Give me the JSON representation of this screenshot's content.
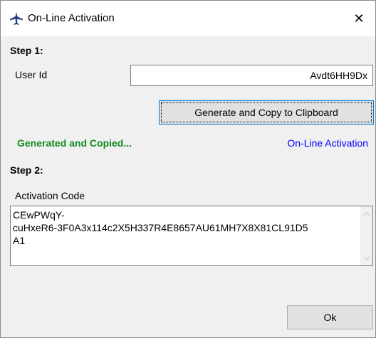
{
  "window": {
    "title": "On-Line Activation",
    "close_glyph": "✕"
  },
  "step1": {
    "heading": "Step 1:",
    "user_id_label": "User Id",
    "user_id_value": "Avdt6HH9Dx",
    "generate_button": "Generate and Copy to Clipboard",
    "status": "Generated and Copied...",
    "activation_link": "On-Line Activation"
  },
  "step2": {
    "heading": "Step 2:",
    "activation_code_label": "Activation Code",
    "activation_code_line1": "CEwPWqY-",
    "activation_code_line2": "cuHxeR6-3F0A3x114c2X5H337R4E8657AU61MH7X8X81CL91D5",
    "activation_code_line3": "A1"
  },
  "footer": {
    "ok_button": "Ok"
  },
  "icons": {
    "title": "airplane-icon",
    "scroll_up": "chevron-up-icon",
    "scroll_down": "chevron-down-icon"
  },
  "colors": {
    "status_green": "#158b1e",
    "link_blue": "#0000ff",
    "title_icon": "#1f3a8a"
  }
}
